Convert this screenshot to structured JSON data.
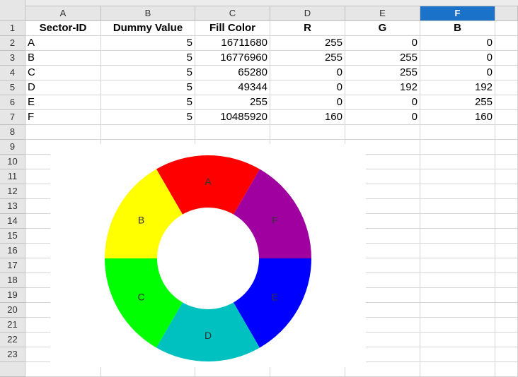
{
  "columns": [
    "A",
    "B",
    "C",
    "D",
    "E",
    "F"
  ],
  "selected_column": "F",
  "rows": [
    "1",
    "2",
    "3",
    "4",
    "5",
    "6",
    "7",
    "8",
    "9",
    "10",
    "11",
    "12",
    "13",
    "14",
    "15",
    "16",
    "17",
    "18",
    "19",
    "20",
    "21",
    "22",
    "23"
  ],
  "headers": [
    "Sector-ID",
    "Dummy Value",
    "Fill Color",
    "R",
    "G",
    "B"
  ],
  "table": [
    [
      "A",
      "5",
      "16711680",
      "255",
      "0",
      "0"
    ],
    [
      "B",
      "5",
      "16776960",
      "255",
      "255",
      "0"
    ],
    [
      "C",
      "5",
      "65280",
      "0",
      "255",
      "0"
    ],
    [
      "D",
      "5",
      "49344",
      "0",
      "192",
      "192"
    ],
    [
      "E",
      "5",
      "255",
      "0",
      "0",
      "255"
    ],
    [
      "F",
      "5",
      "10485920",
      "160",
      "0",
      "160"
    ]
  ],
  "colors": {
    "selected_header": "#1a73c8"
  },
  "chart_data": {
    "type": "pie",
    "donut": true,
    "categories": [
      "A",
      "B",
      "C",
      "D",
      "E",
      "F"
    ],
    "values": [
      5,
      5,
      5,
      5,
      5,
      5
    ],
    "colors": [
      "#ff0000",
      "#ffff00",
      "#00ff00",
      "#00c0c0",
      "#0000ff",
      "#a000a0"
    ],
    "start_angle_deg": -60,
    "direction": "counterclockwise",
    "data_labels": [
      "A",
      "B",
      "C",
      "D",
      "E",
      "F"
    ]
  }
}
